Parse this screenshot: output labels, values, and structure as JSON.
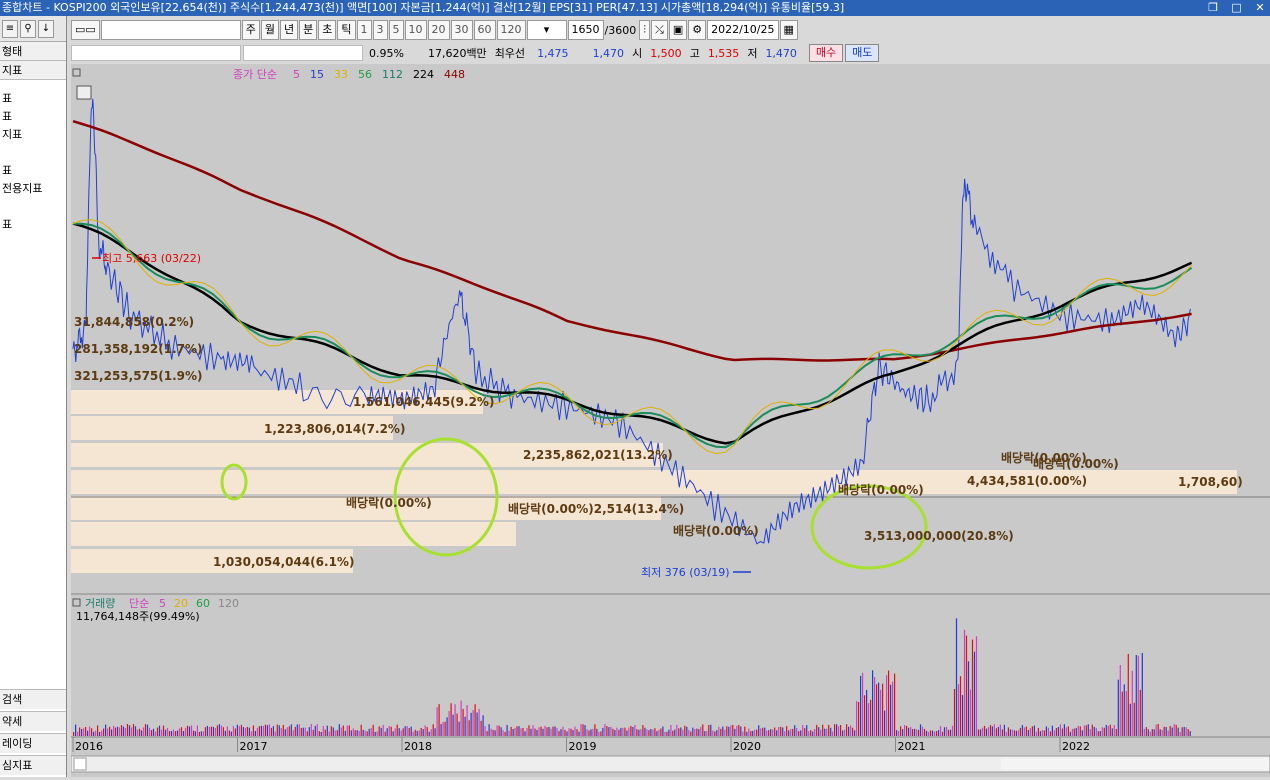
{
  "window": {
    "title": "종합차트 - KOSPI200 외국인보유[22,654(천)] 주식수[1,244,473(천)] 액면[100] 자본금[1,244(억)] 결산[12월] EPS[31] PER[47.13] 시가총액[18,294(억)] 유통비율[59.3]"
  },
  "left_panel": {
    "toolbar_icons": [
      "list-icon",
      "search-icon",
      "download-icon"
    ],
    "header_top": "형태",
    "header_indicator": "지표",
    "items": [
      "표",
      "표",
      "지표",
      "",
      "표",
      "전용지표",
      "",
      "표"
    ],
    "bottom_items": [
      "검색",
      "약세",
      "레이딩",
      "심지표"
    ]
  },
  "toolbar": {
    "periods": [
      "주",
      "월",
      "년",
      "분",
      "초",
      "틱"
    ],
    "intervals": [
      "1",
      "3",
      "5",
      "10",
      "20",
      "30",
      "60",
      "120"
    ],
    "count_value": "1650",
    "count_total": "/3600",
    "date_value": "2022/10/25"
  },
  "quote": {
    "change_pct": "0.95%",
    "amount": "17,620백만",
    "best_sell_label": "최우선",
    "best_ask": "1,475",
    "best_bid": "1,470",
    "open_label": "시",
    "open": "1,500",
    "high_label": "고",
    "high": "1,535",
    "low_label": "저",
    "low": "1,470",
    "buy_label": "매수",
    "sell_label": "매도"
  },
  "price_panel": {
    "legend_prefix": "종가 단순",
    "ma_periods": [
      {
        "label": "5",
        "color": "#d040c0"
      },
      {
        "label": "15",
        "color": "#2040d0"
      },
      {
        "label": "33",
        "color": "#e0b000"
      },
      {
        "label": "56",
        "color": "#20a040"
      },
      {
        "label": "112",
        "color": "#1c7c6c"
      },
      {
        "label": "224",
        "color": "#000000"
      },
      {
        "label": "448",
        "color": "#8b0000"
      }
    ],
    "high_annotation": "최고 5,663 (03/22)",
    "low_annotation": "최저 376 (03/19)",
    "volume_profile_labels": [
      "31,844,858(0.2%)",
      "281,358,192(1.7%)",
      "321,253,575(1.9%)",
      "1,561,046,445(9.2%)",
      "1,223,806,014(7.2%)",
      "2,235,862,021(13.2%)",
      "배당락(0.00%)",
      "배당락(0.00%)2,514(13.4%)",
      "배당락(0.00%)",
      "1,030,054,044(6.1%)",
      "배당락(0.00%)",
      "3,513,000,000(20.8%)",
      "4,434,581(0.00%)",
      "배당락(0.00%)",
      "배당락(0.00%)",
      "1,708,60)"
    ]
  },
  "volume_panel": {
    "legend_prefix": "거래량",
    "legend_mode": "단순",
    "ma_periods": [
      {
        "label": "5",
        "color": "#d040c0"
      },
      {
        "label": "20",
        "color": "#e0b000"
      },
      {
        "label": "60",
        "color": "#20a040"
      },
      {
        "label": "120",
        "color": "#888888"
      }
    ],
    "current_volume": "11,764,148주(99.49%)"
  },
  "x_axis": {
    "years": [
      "2016",
      "2017",
      "2018",
      "2019",
      "2020",
      "2021",
      "2022"
    ]
  },
  "colors": {
    "chart_bg": "#c9c9c9",
    "profile_band": "#f5e6d3",
    "ma448": "#8b0000",
    "ma224": "#000000",
    "price_line": "#2040d0",
    "highlight_circle": "#a8e030"
  },
  "chart_data": {
    "type": "line",
    "title": "",
    "x_range": [
      "2016",
      "2022"
    ],
    "price_ylim": [
      300,
      6000
    ],
    "series": [
      {
        "name": "448",
        "values_by_year": [
          4800,
          3200,
          2100,
          1450,
          1150,
          1150,
          1350
        ]
      },
      {
        "name": "224",
        "values_by_year": [
          2600,
          1450,
          1050,
          900,
          700,
          1050,
          1600
        ]
      }
    ]
  }
}
